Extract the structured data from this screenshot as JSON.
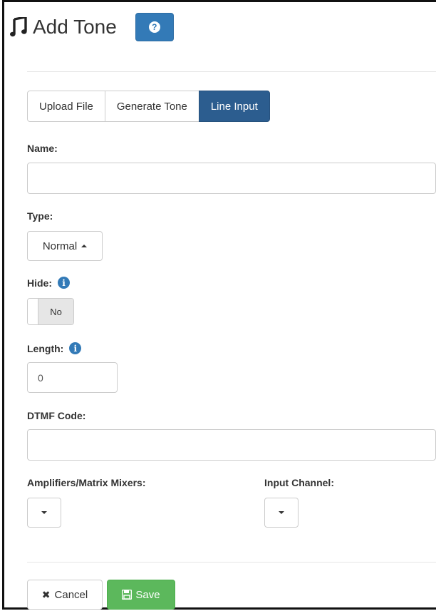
{
  "header": {
    "title": "Add Tone",
    "icon": "music-note-icon",
    "help_label": "?"
  },
  "tabs": [
    {
      "label": "Upload File",
      "active": false
    },
    {
      "label": "Generate Tone",
      "active": false
    },
    {
      "label": "Line Input",
      "active": true
    }
  ],
  "form": {
    "name": {
      "label": "Name:",
      "value": ""
    },
    "type": {
      "label": "Type:",
      "selected": "Normal"
    },
    "hide": {
      "label": "Hide:",
      "state": "No",
      "info_icon": "info-icon"
    },
    "length": {
      "label": "Length:",
      "value": "0",
      "info_icon": "info-icon"
    },
    "dtmf": {
      "label": "DTMF Code:",
      "value": ""
    },
    "amplifiers": {
      "label": "Amplifiers/Matrix Mixers:",
      "selected": ""
    },
    "input_channel": {
      "label": "Input Channel:",
      "selected": ""
    }
  },
  "footer": {
    "cancel_label": "Cancel",
    "cancel_icon": "close-icon",
    "save_label": "Save",
    "save_icon": "floppy-disk-icon"
  },
  "colors": {
    "primary": "#337ab7",
    "active_tab": "#2c5d8f",
    "success": "#5cb85c"
  }
}
